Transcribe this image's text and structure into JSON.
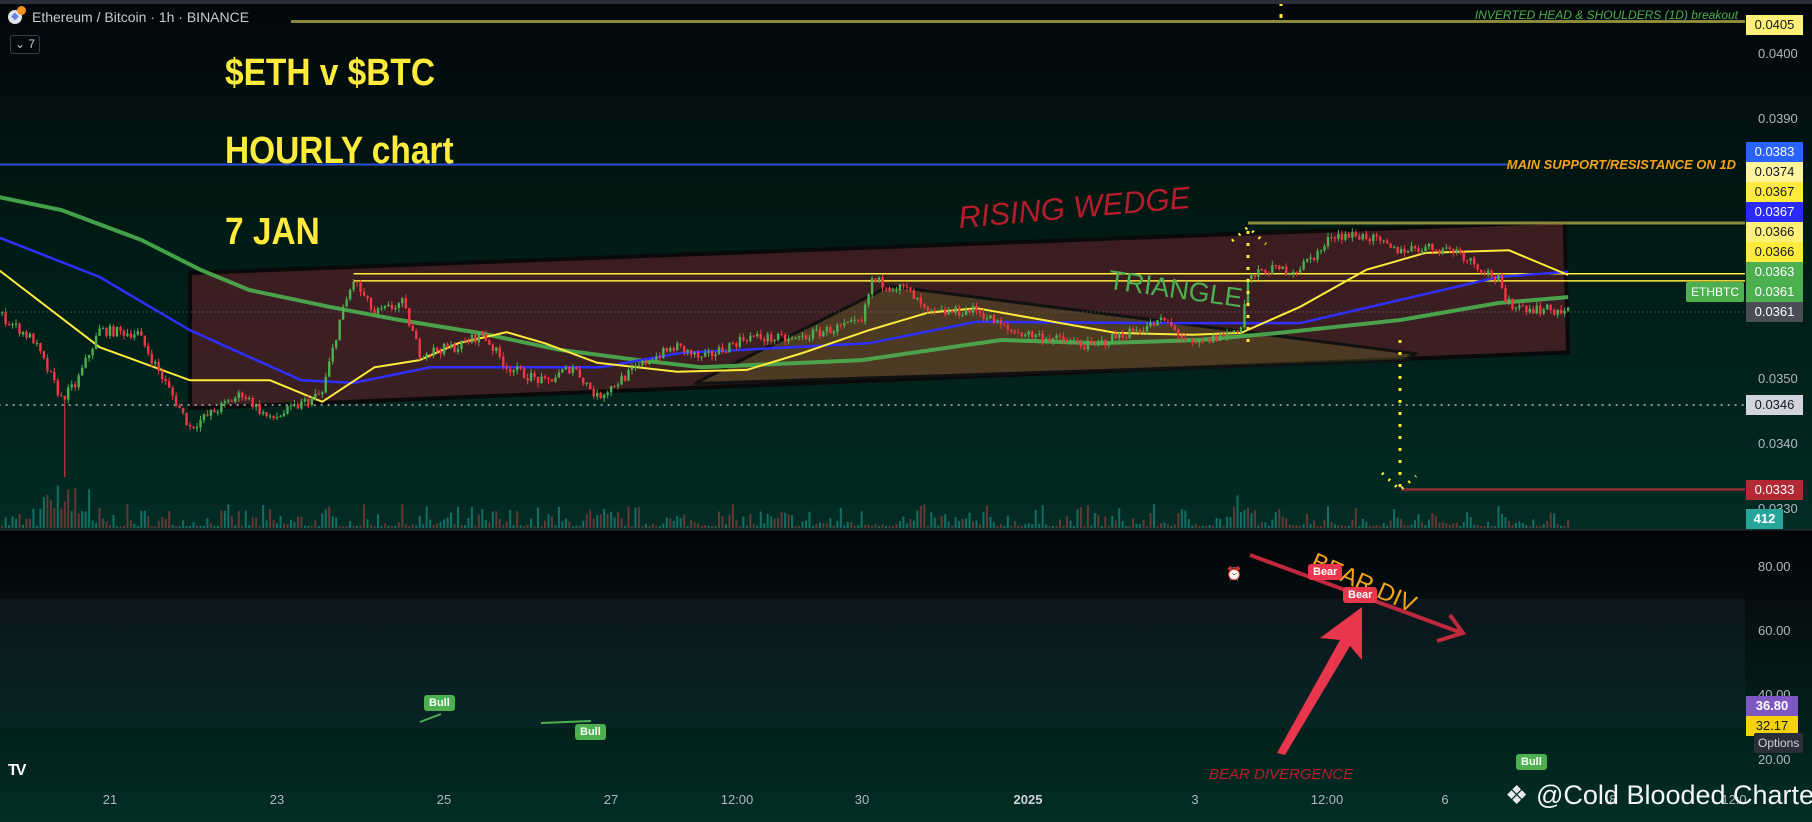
{
  "header": {
    "symbol_title": "Ethereum / Bitcoin · 1h · BINANCE",
    "collapse_button": "⌄ 7"
  },
  "overlay_text": {
    "line1": "$ETH v $BTC",
    "line2": "HOURLY chart",
    "line3": "7 JAN"
  },
  "annotations": {
    "rising_wedge": "RISING WEDGE",
    "triangle": "TRIANGLE",
    "inverted_hs": "INVERTED HEAD & SHOULDERS (1D) breakout",
    "main_sr": "MAIN SUPPORT/RESISTANCE ON 1D",
    "bear_div": "BEAR DIV",
    "bear_divergence": "BEAR DIVERGENCE",
    "bull_tags": [
      "Bull",
      "Bull",
      "Bull"
    ],
    "bear_tags": [
      "Bear",
      "Bear"
    ]
  },
  "price_axis": {
    "ticks": [
      "0.0400",
      "0.0390",
      "0.0350",
      "0.0340",
      "0.0330"
    ],
    "labels": [
      {
        "text": "0.0405",
        "bg": "#fff176",
        "fg": "#131722"
      },
      {
        "text": "0.0383",
        "bg": "#2962ff",
        "fg": "#ffffff"
      },
      {
        "text": "0.0374",
        "bg": "#fff59d",
        "fg": "#131722"
      },
      {
        "text": "0.0367",
        "bg": "#ffeb3b",
        "fg": "#131722"
      },
      {
        "text": "0.0367",
        "bg": "#2a2aff",
        "fg": "#ffffff"
      },
      {
        "text": "0.0366",
        "bg": "#fff176",
        "fg": "#131722"
      },
      {
        "text": "0.0366",
        "bg": "#ffeb3b",
        "fg": "#131722"
      },
      {
        "text": "0.0363",
        "bg": "#4caf50",
        "fg": "#ffffff"
      },
      {
        "text": "0.0361",
        "bg": "#4caf50",
        "fg": "#ffffff"
      },
      {
        "text": "0.0361",
        "bg": "#4a4d55",
        "fg": "#ffffff"
      },
      {
        "text": "0.0346",
        "bg": "#d1d4dc",
        "fg": "#131722"
      },
      {
        "text": "0.0333",
        "bg": "#b22833",
        "fg": "#ffffff"
      }
    ],
    "symbol_tag": "ETHBTC",
    "volume_label": "412"
  },
  "rsi_axis": {
    "ticks": [
      "80.00",
      "60.00",
      "40.00",
      "20.00"
    ],
    "rsi_value": "36.80",
    "rsi_ma_value": "32.17",
    "options_tooltip": "Options"
  },
  "time_axis": {
    "labels": [
      "21",
      "23",
      "25",
      "27",
      "12:00",
      "30",
      "2025",
      "3",
      "12:00",
      "6",
      "8",
      "12:0"
    ]
  },
  "watermark": "@Cold Blooded Charter",
  "colors": {
    "up": "#4caf50",
    "down": "#f23645",
    "ma_fast": "#ffeb3b",
    "ma_mid": "#2f2fff",
    "ma_slow": "#4caf50",
    "rsi": "#7e57c2",
    "rsi_ma": "#f5d10a",
    "wedge": "#5a1e24",
    "bear": "#e8364c",
    "bull": "#4caf50"
  },
  "chart_data": {
    "type": "line",
    "title": "Ethereum / Bitcoin · 1h · BINANCE",
    "x_unit": "hours since Dec 21 00:00",
    "xlim": [
      -32,
      470
    ],
    "ylim": [
      0.0328,
      0.0408
    ],
    "close": [
      [
        -32,
        0.036
      ],
      [
        -22,
        0.0356
      ],
      [
        -14,
        0.0347
      ],
      [
        -10,
        0.0349
      ],
      [
        -3,
        0.03575
      ],
      [
        8,
        0.0357
      ],
      [
        23,
        0.03426
      ],
      [
        38,
        0.03478
      ],
      [
        46,
        0.03437
      ],
      [
        61,
        0.03478
      ],
      [
        66,
        0.0359
      ],
      [
        70,
        0.03652
      ],
      [
        76,
        0.036
      ],
      [
        84,
        0.03617
      ],
      [
        89,
        0.0354
      ],
      [
        100,
        0.0355
      ],
      [
        107,
        0.0357
      ],
      [
        114,
        0.03519
      ],
      [
        125,
        0.03494
      ],
      [
        133,
        0.0352
      ],
      [
        140,
        0.03472
      ],
      [
        147,
        0.035
      ],
      [
        155,
        0.0353
      ],
      [
        163,
        0.0355
      ],
      [
        170,
        0.0353
      ],
      [
        183,
        0.03565
      ],
      [
        196,
        0.0356
      ],
      [
        206,
        0.03575
      ],
      [
        216,
        0.03586
      ],
      [
        219,
        0.03652
      ],
      [
        229,
        0.03637
      ],
      [
        235,
        0.036
      ],
      [
        249,
        0.03606
      ],
      [
        258,
        0.03575
      ],
      [
        268,
        0.03565
      ],
      [
        282,
        0.0355
      ],
      [
        289,
        0.03565
      ],
      [
        303,
        0.0359
      ],
      [
        311,
        0.0355
      ],
      [
        321,
        0.0357
      ],
      [
        325,
        0.0358
      ],
      [
        327,
        0.03652
      ],
      [
        332,
        0.03668
      ],
      [
        341,
        0.03668
      ],
      [
        349,
        0.03703
      ],
      [
        351,
        0.03722
      ],
      [
        361,
        0.0372
      ],
      [
        369,
        0.03698
      ],
      [
        378,
        0.03703
      ],
      [
        387,
        0.03698
      ],
      [
        392,
        0.03678
      ],
      [
        399,
        0.03652
      ],
      [
        401,
        0.03617
      ],
      [
        407,
        0.0361
      ],
      [
        419,
        0.03603
      ]
    ],
    "wick_low": [
      -13,
      0.03349
    ],
    "ma_fast": [
      [
        -32,
        0.03668
      ],
      [
        -3,
        0.03549
      ],
      [
        23,
        0.03498
      ],
      [
        46,
        0.03498
      ],
      [
        61,
        0.03465
      ],
      [
        76,
        0.03518
      ],
      [
        89,
        0.03529
      ],
      [
        100,
        0.03555
      ],
      [
        114,
        0.03572
      ],
      [
        125,
        0.03555
      ],
      [
        140,
        0.03525
      ],
      [
        163,
        0.03511
      ],
      [
        183,
        0.03514
      ],
      [
        199,
        0.0354
      ],
      [
        218,
        0.03575
      ],
      [
        235,
        0.03602
      ],
      [
        249,
        0.03609
      ],
      [
        268,
        0.03591
      ],
      [
        289,
        0.03571
      ],
      [
        311,
        0.03568
      ],
      [
        325,
        0.03571
      ],
      [
        342,
        0.03611
      ],
      [
        361,
        0.03668
      ],
      [
        378,
        0.03694
      ],
      [
        402,
        0.03698
      ],
      [
        419,
        0.0366
      ]
    ],
    "ma_mid": [
      [
        -32,
        0.03718
      ],
      [
        -3,
        0.03657
      ],
      [
        23,
        0.03575
      ],
      [
        55,
        0.03498
      ],
      [
        70,
        0.03494
      ],
      [
        92,
        0.03518
      ],
      [
        141,
        0.03518
      ],
      [
        164,
        0.0354
      ],
      [
        218,
        0.03555
      ],
      [
        249,
        0.03588
      ],
      [
        303,
        0.03586
      ],
      [
        342,
        0.03586
      ],
      [
        371,
        0.03622
      ],
      [
        399,
        0.03657
      ],
      [
        419,
        0.03665
      ]
    ],
    "ma_slow": [
      [
        -32,
        0.0378
      ],
      [
        -14,
        0.0376
      ],
      [
        9,
        0.03714
      ],
      [
        26,
        0.03668
      ],
      [
        40,
        0.03637
      ],
      [
        63,
        0.03611
      ],
      [
        83,
        0.03591
      ],
      [
        106,
        0.03571
      ],
      [
        129,
        0.03545
      ],
      [
        152,
        0.03529
      ],
      [
        170,
        0.03518
      ],
      [
        216,
        0.03529
      ],
      [
        256,
        0.0356
      ],
      [
        284,
        0.03555
      ],
      [
        313,
        0.0356
      ],
      [
        336,
        0.03571
      ],
      [
        371,
        0.03591
      ],
      [
        399,
        0.03617
      ],
      [
        419,
        0.03626
      ]
    ],
    "hlines": [
      {
        "price": 0.0405,
        "from": 52,
        "label": "INVERTED HEAD & SHOULDERS (1D) breakout"
      },
      {
        "price": 0.0383,
        "from": -32,
        "label": "MAIN SUPPORT/RESISTANCE ON 1D"
      },
      {
        "price": 0.0374,
        "from": 327
      },
      {
        "price": 0.03662,
        "from": 70
      },
      {
        "price": 0.03651,
        "from": 70
      },
      {
        "price": 0.0346,
        "from": -32,
        "style": "dotted"
      },
      {
        "price": 0.03603,
        "from": -32,
        "style": "dotted"
      },
      {
        "price": 0.0333,
        "from": 371
      }
    ],
    "wedge": [
      [
        23,
        0.03663
      ],
      [
        418,
        0.03742
      ],
      [
        419,
        0.03541
      ],
      [
        23,
        0.03455
      ]
    ],
    "triangle": [
      [
        168,
        0.03493
      ],
      [
        224,
        0.03643
      ],
      [
        375,
        0.03539
      ],
      [
        372,
        0.03528
      ]
    ],
    "rsi": [
      [
        -32,
        33.7
      ],
      [
        -30,
        21
      ],
      [
        -22,
        40
      ],
      [
        -12,
        19
      ],
      [
        -11,
        41
      ],
      [
        -4,
        62
      ],
      [
        2,
        55
      ],
      [
        6,
        60
      ],
      [
        10,
        48
      ],
      [
        17,
        37
      ],
      [
        22,
        27.5
      ],
      [
        26,
        41.4
      ],
      [
        34,
        55
      ],
      [
        39,
        38
      ],
      [
        42,
        52
      ],
      [
        44,
        41
      ],
      [
        52,
        58.5
      ],
      [
        55,
        48
      ],
      [
        61,
        55
      ],
      [
        65,
        77.5
      ],
      [
        67,
        68
      ],
      [
        69,
        78.5
      ],
      [
        75,
        60.5
      ],
      [
        78,
        64.6
      ],
      [
        85,
        61.5
      ],
      [
        88,
        40
      ],
      [
        93,
        44.5
      ],
      [
        96,
        41
      ],
      [
        102,
        51
      ],
      [
        107,
        56
      ],
      [
        110,
        42
      ],
      [
        114,
        32
      ],
      [
        118,
        41
      ],
      [
        124,
        31
      ],
      [
        130,
        56
      ],
      [
        134,
        46
      ],
      [
        136,
        32
      ],
      [
        139,
        40.4
      ],
      [
        146,
        53
      ],
      [
        151,
        58
      ],
      [
        154,
        62.6
      ],
      [
        157,
        50
      ],
      [
        162,
        64.6
      ],
      [
        166,
        48
      ],
      [
        169,
        57.4
      ],
      [
        179,
        50.7
      ],
      [
        184,
        63.6
      ],
      [
        188,
        68.8
      ],
      [
        191,
        67.7
      ],
      [
        196,
        49
      ],
      [
        200,
        60.5
      ],
      [
        207,
        48.7
      ],
      [
        211,
        63.6
      ],
      [
        215,
        54.3
      ],
      [
        218,
        74
      ],
      [
        221,
        69.3
      ],
      [
        224,
        74.4
      ],
      [
        229,
        61.5
      ],
      [
        230,
        45
      ],
      [
        233,
        54.3
      ],
      [
        235,
        43
      ],
      [
        240,
        54.3
      ],
      [
        241,
        46
      ],
      [
        247,
        50.2
      ],
      [
        249,
        45
      ],
      [
        252,
        41
      ],
      [
        256,
        36.8
      ],
      [
        258,
        42
      ],
      [
        260,
        36.8
      ],
      [
        266,
        44
      ],
      [
        270,
        42
      ],
      [
        276,
        47.6
      ],
      [
        278,
        37.8
      ],
      [
        281,
        34.7
      ],
      [
        287,
        35.3
      ],
      [
        289,
        52.3
      ],
      [
        291,
        55.4
      ],
      [
        294,
        54.3
      ],
      [
        298,
        66
      ],
      [
        301,
        70.8
      ],
      [
        303,
        67.7
      ],
      [
        305,
        44
      ],
      [
        309,
        32.7
      ],
      [
        313,
        54.3
      ],
      [
        316,
        51
      ],
      [
        320,
        48
      ],
      [
        322,
        49
      ],
      [
        324,
        60.5
      ],
      [
        326,
        77
      ],
      [
        328,
        83.7
      ],
      [
        330,
        73
      ],
      [
        334,
        75
      ],
      [
        338,
        62.6
      ],
      [
        342,
        64
      ],
      [
        345,
        59.5
      ],
      [
        346,
        63.6
      ],
      [
        349,
        75.5
      ],
      [
        352,
        61.5
      ],
      [
        356,
        61.5
      ],
      [
        360,
        67.7
      ],
      [
        362,
        58.5
      ],
      [
        366,
        51.2
      ],
      [
        370,
        54.3
      ],
      [
        375,
        52.8
      ],
      [
        378,
        61.5
      ],
      [
        380,
        52.3
      ],
      [
        384,
        42
      ],
      [
        387,
        52.8
      ],
      [
        391,
        36.8
      ],
      [
        395,
        43
      ],
      [
        399,
        26.5
      ],
      [
        402,
        17.2
      ],
      [
        406,
        24.4
      ],
      [
        409,
        22.4
      ],
      [
        410,
        39.4
      ],
      [
        414,
        34.7
      ],
      [
        416,
        35.3
      ],
      [
        419,
        36.8
      ]
    ],
    "rsi_ma": [
      [
        -32,
        36.8
      ],
      [
        -22,
        31
      ],
      [
        -10,
        29.6
      ],
      [
        -3,
        35.8
      ],
      [
        2,
        53.3
      ],
      [
        8,
        58
      ],
      [
        15,
        49
      ],
      [
        26,
        34.7
      ],
      [
        32,
        36.8
      ],
      [
        39,
        46.6
      ],
      [
        43,
        48.1
      ],
      [
        51,
        46
      ],
      [
        55,
        47.6
      ],
      [
        64,
        55.4
      ],
      [
        72,
        66.7
      ],
      [
        77,
        68.5
      ],
      [
        85,
        63
      ],
      [
        93,
        52.3
      ],
      [
        100,
        43
      ],
      [
        109,
        47.1
      ],
      [
        117,
        41
      ],
      [
        125,
        37.3
      ],
      [
        134,
        42
      ],
      [
        144,
        41
      ],
      [
        154,
        48
      ],
      [
        164,
        56.4
      ],
      [
        172,
        55.4
      ],
      [
        179,
        54.3
      ],
      [
        193,
        63.6
      ],
      [
        201,
        59.5
      ],
      [
        209,
        56.4
      ],
      [
        215,
        58.5
      ],
      [
        221,
        63
      ],
      [
        229,
        67.7
      ],
      [
        234,
        66
      ],
      [
        240,
        57.4
      ],
      [
        247,
        50.2
      ],
      [
        251,
        49.4
      ],
      [
        256,
        45
      ],
      [
        265,
        40.4
      ],
      [
        276,
        43
      ],
      [
        287,
        38.4
      ],
      [
        294,
        47.1
      ],
      [
        303,
        61.5
      ],
      [
        311,
        54.3
      ],
      [
        318,
        45
      ],
      [
        324,
        50.2
      ],
      [
        331,
        61.5
      ],
      [
        338,
        74
      ],
      [
        344,
        70.8
      ],
      [
        349,
        65.7
      ],
      [
        358,
        65.2
      ],
      [
        361,
        66
      ],
      [
        369,
        59.5
      ],
      [
        375,
        54.3
      ],
      [
        380,
        54.8
      ],
      [
        387,
        52.8
      ],
      [
        396,
        45
      ],
      [
        404,
        34.7
      ],
      [
        409,
        26.7
      ],
      [
        414,
        27.5
      ],
      [
        419,
        32.2
      ]
    ],
    "rsi_levels": [
      70,
      50,
      30
    ],
    "rsi_ylim": [
      15,
      92
    ]
  }
}
